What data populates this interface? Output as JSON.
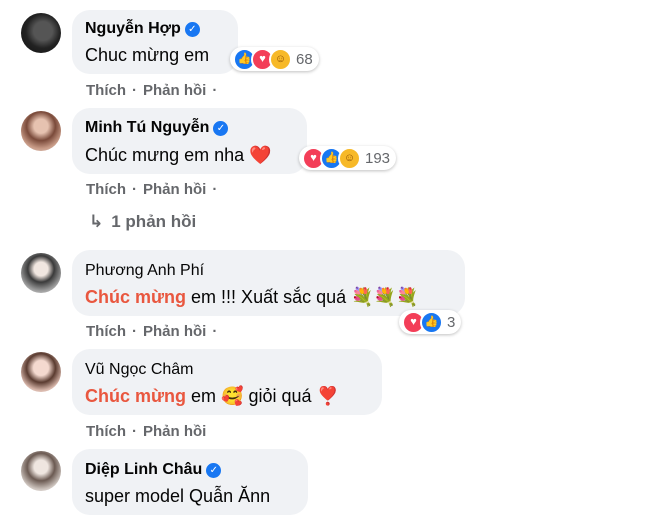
{
  "action_labels": {
    "like": "Thích",
    "reply": "Phản hồi",
    "dot": "·"
  },
  "comments": [
    {
      "name": "Nguyễn Hợp",
      "verified": true,
      "text": "Chuc mừng em",
      "reaction_count": "68"
    },
    {
      "name": "Minh Tú Nguyễn",
      "verified": true,
      "text": "Chúc mưng em nha",
      "text_emoji": "❤️",
      "reaction_count": "193",
      "replies_link": "1 phản hồi",
      "replies_icon": "↳"
    },
    {
      "name": "Phương Anh Phí",
      "verified": false,
      "highlight": "Chúc mừng",
      "text": "em !!! Xuất sắc quá",
      "text_emoji": "💐💐💐",
      "reaction_count": "3"
    },
    {
      "name": "Vũ Ngọc Châm",
      "verified": false,
      "highlight": "Chúc mừng",
      "text": "em",
      "text_emoji_1": "🥰",
      "text_2": "giỏi quá",
      "text_emoji_2": "❣️"
    },
    {
      "name": "Diệp Linh Châu",
      "verified": true,
      "text": "super model Quẫn Ănn"
    }
  ],
  "icons": {
    "verified": "verified-badge-icon",
    "like": "like-reaction-icon",
    "love": "love-reaction-icon",
    "care": "care-reaction-icon"
  },
  "colors": {
    "bubble": "#f0f2f5",
    "verified": "#1877f2",
    "highlight": "#e9573f",
    "meta_text": "#65676b"
  }
}
